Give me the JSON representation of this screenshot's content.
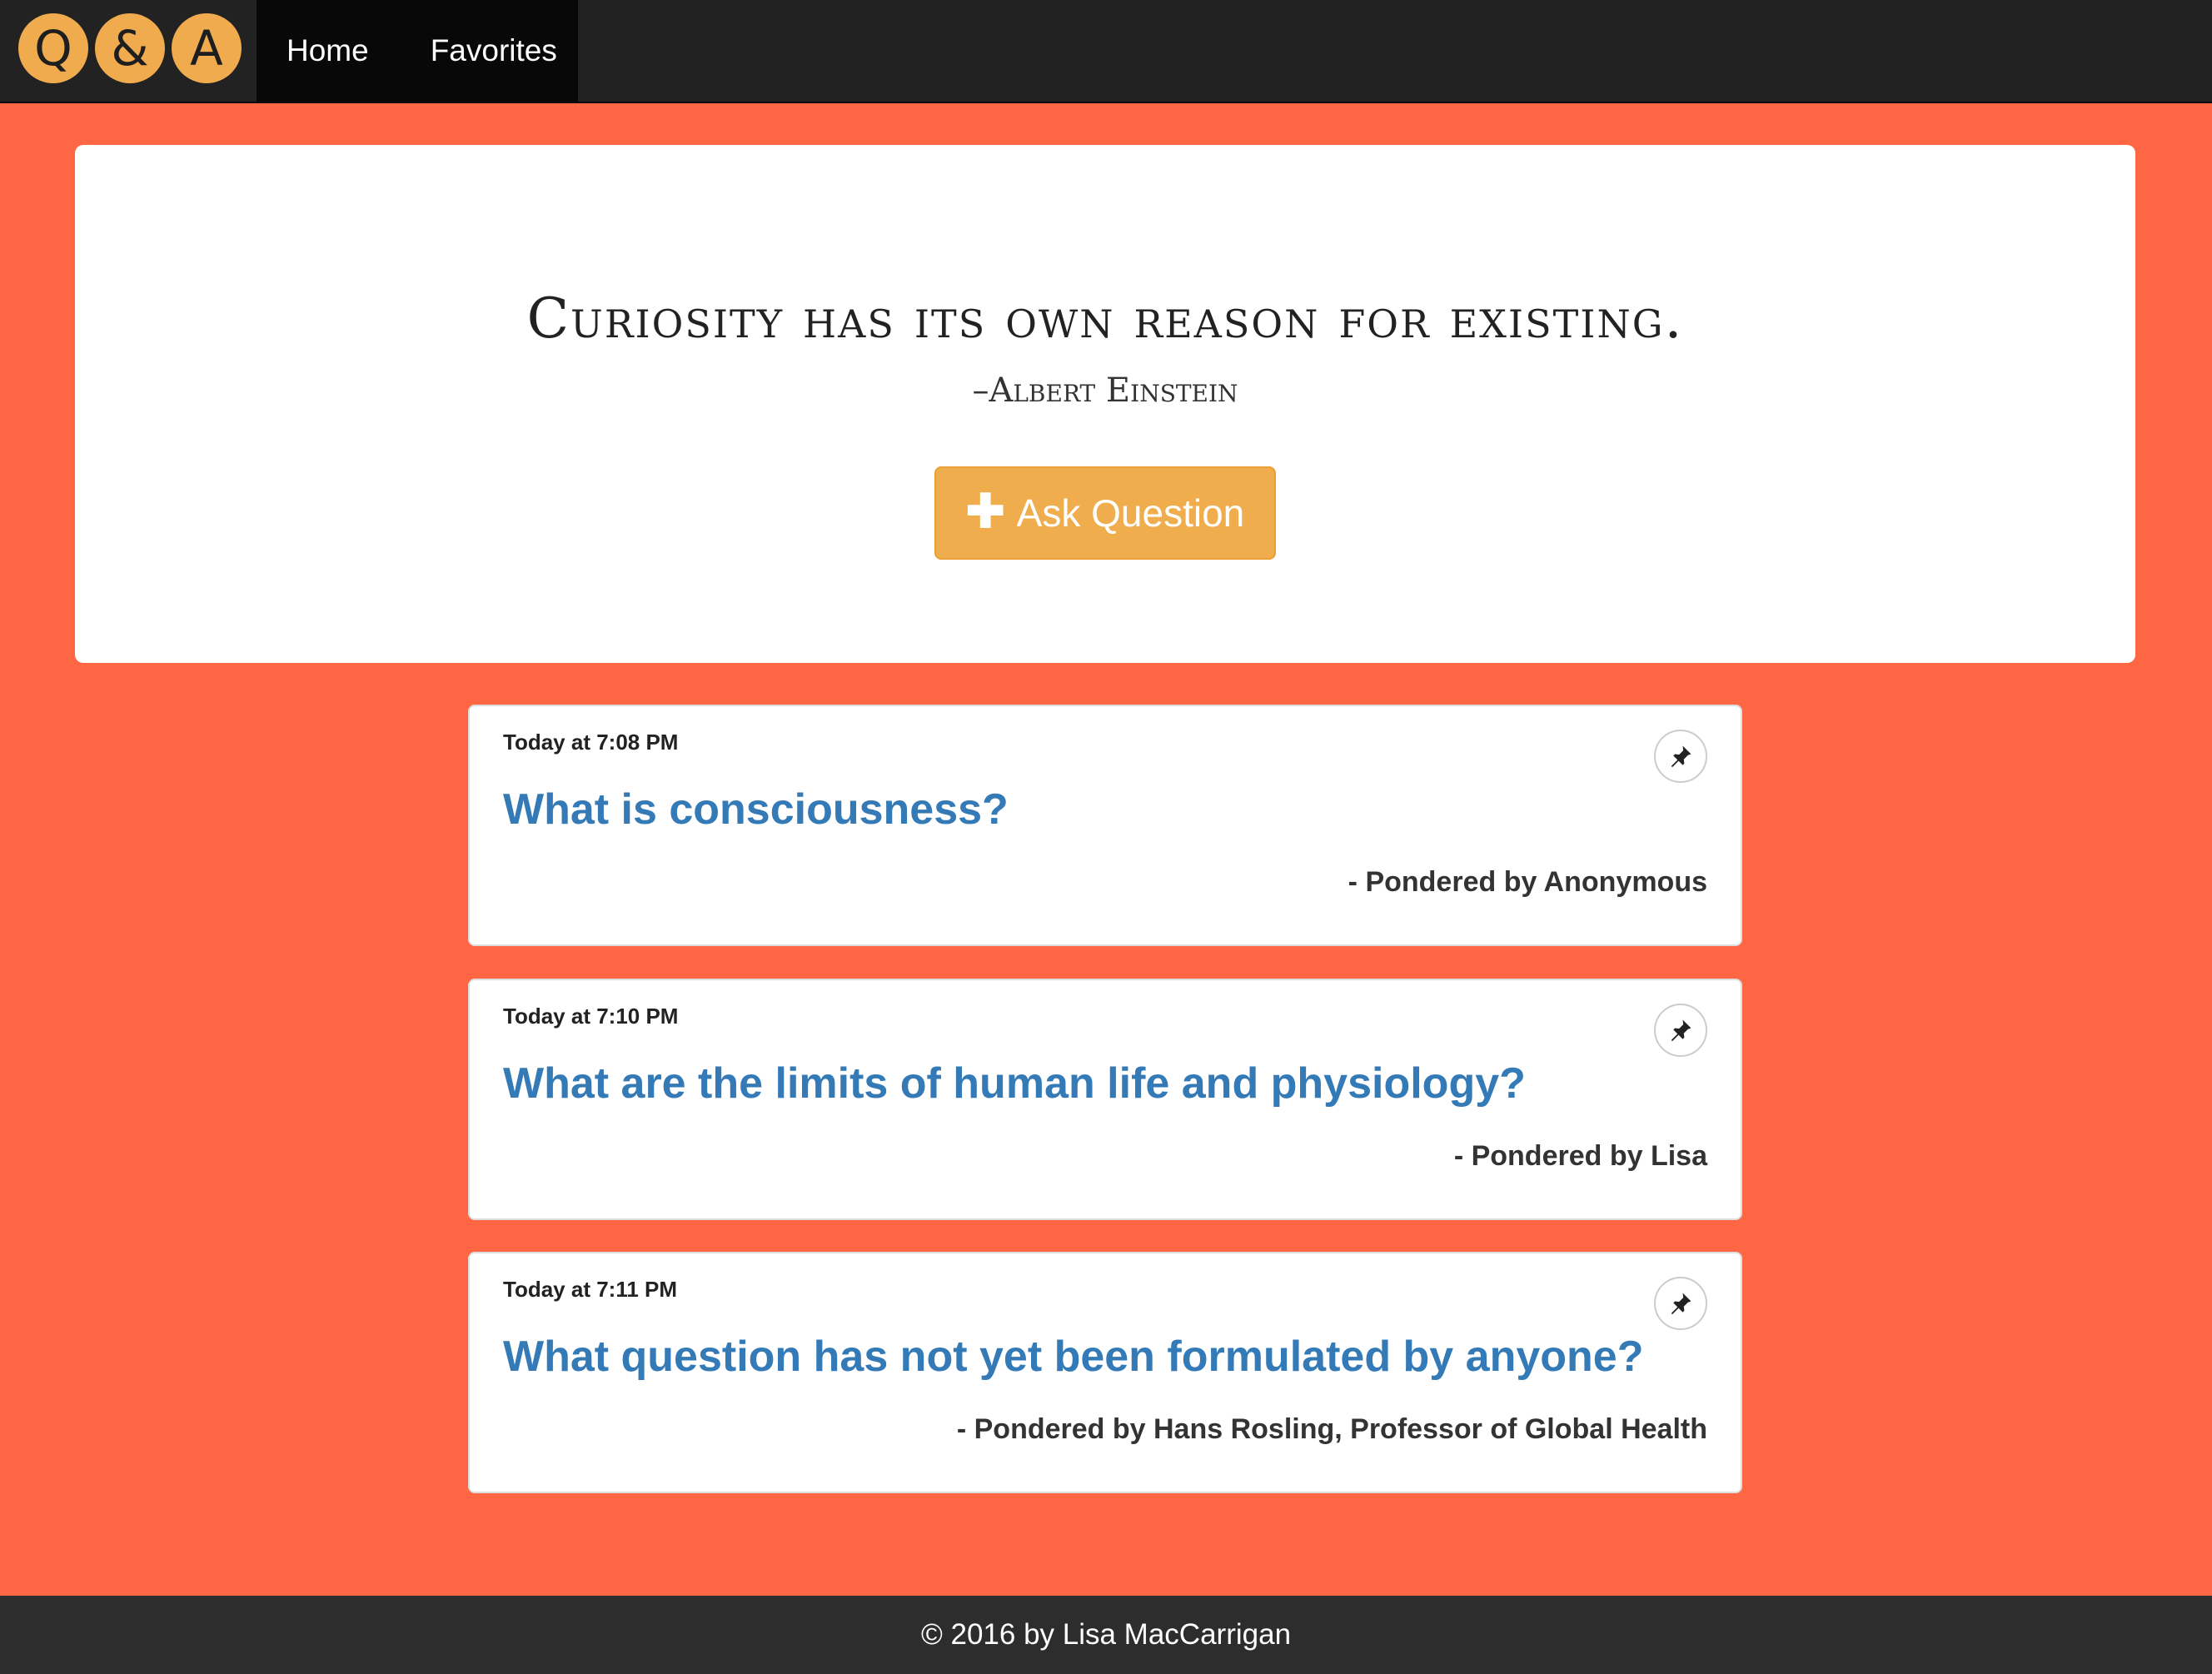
{
  "nav": {
    "logo_letters": [
      "Q",
      "&",
      "A"
    ],
    "links": [
      "Home",
      "Favorites"
    ]
  },
  "jumbotron": {
    "quote": "Curiosity has its own reason for existing.",
    "author": "–Albert Einstein",
    "button_label": "Ask Question",
    "button_icon": "plus-icon"
  },
  "questions": [
    {
      "time": "Today at 7:08 PM",
      "question": "What is consciousness?",
      "author": "- Pondered by Anonymous",
      "icon": "pin-icon"
    },
    {
      "time": "Today at 7:10 PM",
      "question": "What are the limits of human life and physiology?",
      "author": "- Pondered by Lisa",
      "icon": "pin-icon"
    },
    {
      "time": "Today at 7:11 PM",
      "question": "What question has not yet been formulated by anyone?",
      "author": "- Pondered by Hans Rosling, Professor of Global Health",
      "icon": "pin-icon"
    }
  ],
  "footer": {
    "text": "© 2016 by Lisa MacCarrigan"
  },
  "colors": {
    "background": "#ff6744",
    "accent": "#efad4e",
    "link": "#337ab7",
    "navbar": "#222222"
  }
}
